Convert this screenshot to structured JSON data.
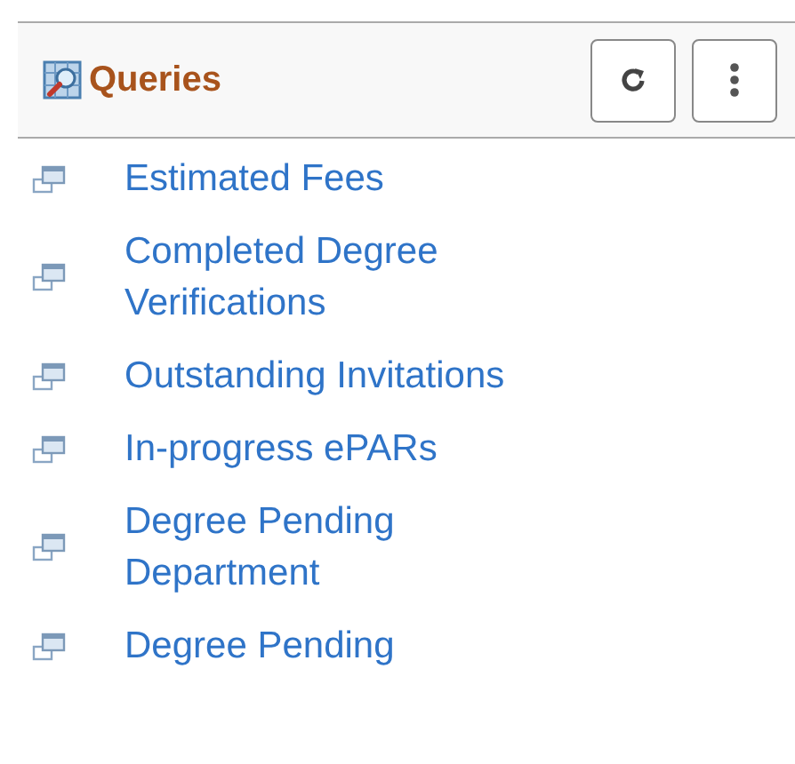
{
  "header": {
    "title": "Queries"
  },
  "items": [
    {
      "label": "Estimated Fees"
    },
    {
      "label": "Completed Degree Verifications"
    },
    {
      "label": "Outstanding Invitations"
    },
    {
      "label": "In-progress ePARs"
    },
    {
      "label": "Degree Pending Department"
    },
    {
      "label": "Degree Pending"
    }
  ]
}
